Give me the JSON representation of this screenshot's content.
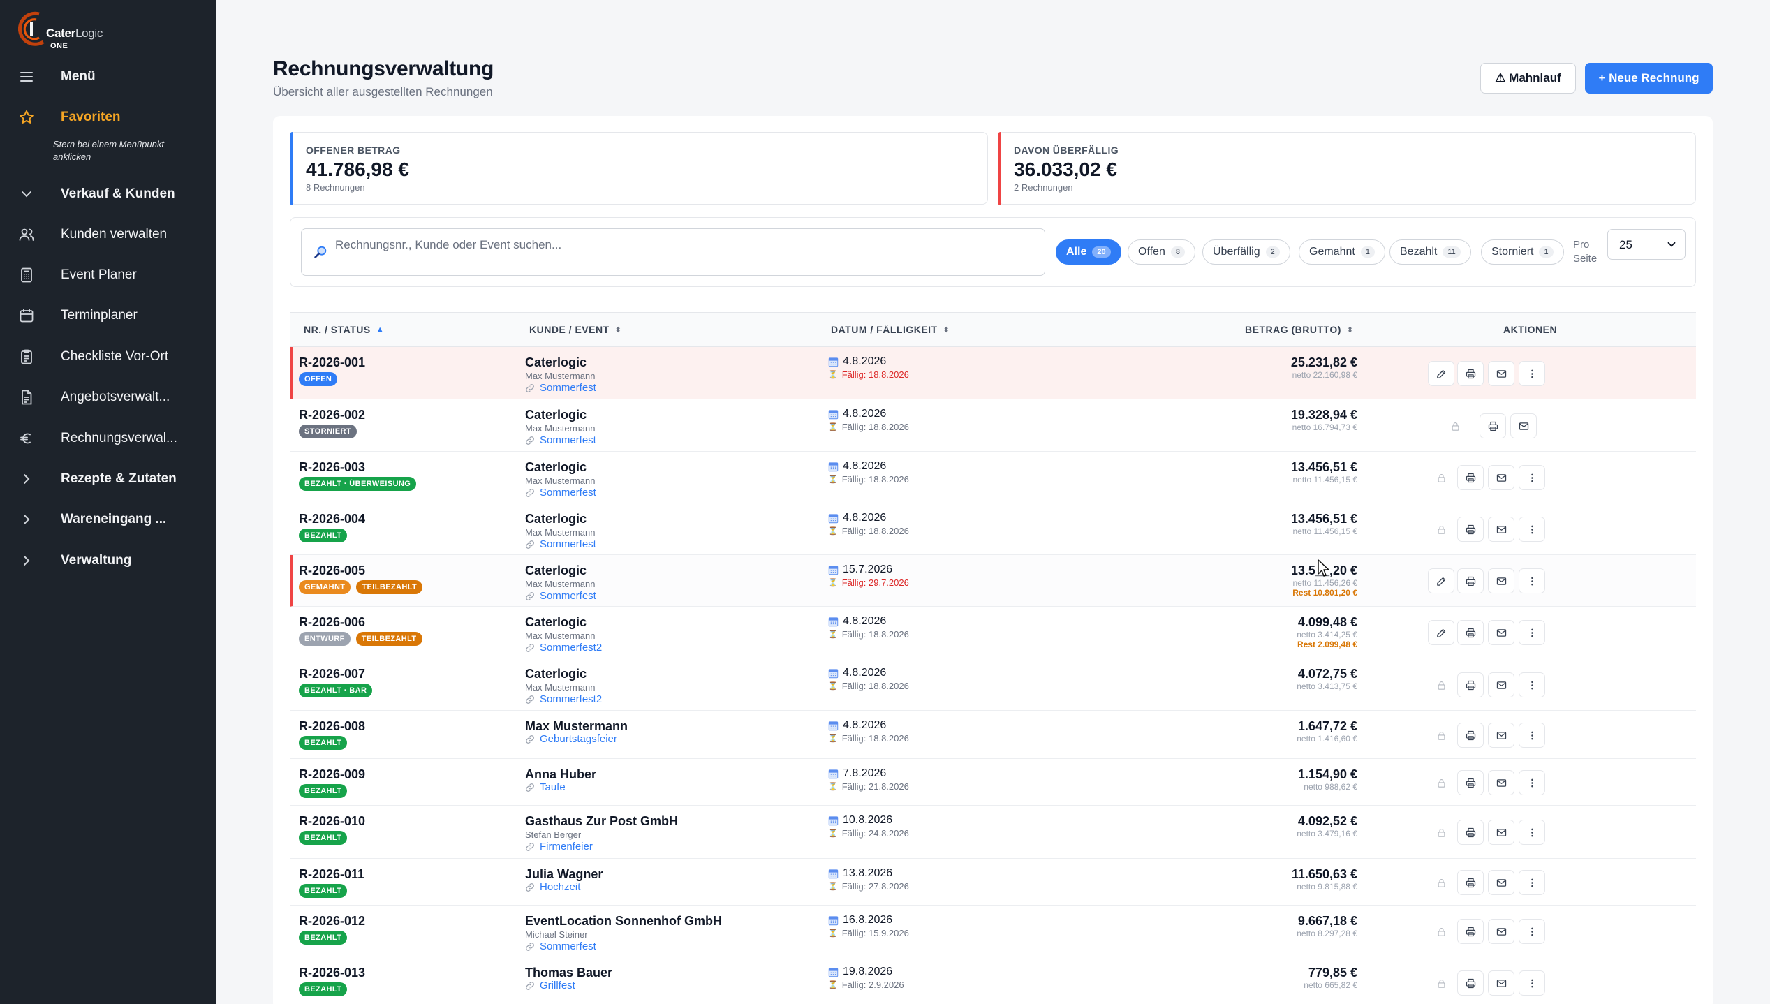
{
  "brand": {
    "name_bold": "Cater",
    "name_light": "Logic",
    "suffix": "ONE"
  },
  "sidebar": {
    "menu_label": "Menü",
    "favorites_label": "Favoriten",
    "favorites_hint": "Stern bei einem Menüpunkt anklicken",
    "items": [
      {
        "label": "Verkauf & Kunden",
        "icon": "chevron-down-icon"
      },
      {
        "label": "Kunden verwalten",
        "icon": "users-icon"
      },
      {
        "label": "Event Planer",
        "icon": "calculator-icon"
      },
      {
        "label": "Terminplaner",
        "icon": "calendar-icon"
      },
      {
        "label": "Checkliste Vor-Ort",
        "icon": "clipboard-icon"
      },
      {
        "label": "Angebotsverwalt...",
        "icon": "document-icon"
      },
      {
        "label": "Rechnungsverwal...",
        "icon": "euro-icon"
      },
      {
        "label": "Rezepte & Zutaten",
        "icon": "chevron-right-icon"
      },
      {
        "label": "Wareneingang ...",
        "icon": "chevron-right-icon"
      },
      {
        "label": "Verwaltung",
        "icon": "chevron-right-icon"
      }
    ]
  },
  "header": {
    "title": "Rechnungsverwaltung",
    "subtitle": "Übersicht aller ausgestellten Rechnungen",
    "mahnlauf_label": "⚠ Mahnlauf",
    "new_invoice_label": "+ Neue Rechnung"
  },
  "stats": {
    "open": {
      "label": "OFFENER BETRAG",
      "value": "41.786,98 €",
      "sub": "8 Rechnungen",
      "color": "#2f7cf6"
    },
    "overdue": {
      "label": "DAVON ÜBERFÄLLIG",
      "value": "36.033,02 €",
      "sub": "2 Rechnungen",
      "color": "#ef4444"
    }
  },
  "filters": {
    "search_placeholder": "Rechnungsnr., Kunde oder Event suchen...",
    "chips": [
      {
        "label": "Alle",
        "count": "20"
      },
      {
        "label": "Offen",
        "count": "8"
      },
      {
        "label": "Überfällig",
        "count": "2"
      },
      {
        "label": "Gemahnt",
        "count": "1"
      },
      {
        "label": "Bezahlt",
        "count": "11"
      },
      {
        "label": "Storniert",
        "count": "1"
      }
    ],
    "per_page_label_1": "Pro",
    "per_page_label_2": "Seite",
    "per_page_value": "25"
  },
  "table": {
    "columns": [
      "NR. / STATUS",
      "KUNDE / EVENT",
      "DATUM / FÄLLIGKEIT",
      "BETRAG (BRUTTO)",
      "AKTIONEN"
    ],
    "sort_icons": [
      "▲",
      "⬍",
      "⬍",
      "⬍"
    ],
    "rows": [
      {
        "nr": "R-2026-001",
        "badges": [
          {
            "text": "OFFEN",
            "color": "#2f7cf6"
          }
        ],
        "customer": "Caterlogic",
        "contact": "Max Mustermann",
        "event": "Sommerfest",
        "date": "4.8.2026",
        "due": "Fällig: 18.8.2026",
        "overdue": true,
        "amount": "25.231,82 €",
        "netto": "netto 22.160,98 €",
        "rest": "",
        "actions": [
          "edit",
          "print",
          "mail",
          "more"
        ]
      },
      {
        "nr": "R-2026-002",
        "badges": [
          {
            "text": "STORNIERT",
            "color": "#6b7280"
          }
        ],
        "customer": "Caterlogic",
        "contact": "Max Mustermann",
        "event": "Sommerfest",
        "date": "4.8.2026",
        "due": "Fällig: 18.8.2026",
        "overdue": false,
        "amount": "19.328,94 €",
        "netto": "netto 16.794,73 €",
        "rest": "",
        "actions": [
          "lock",
          "print",
          "mail"
        ]
      },
      {
        "nr": "R-2026-003",
        "badges": [
          {
            "text": "BEZAHLT · ÜBERWEISUNG",
            "color": "#16a34a"
          }
        ],
        "customer": "Caterlogic",
        "contact": "Max Mustermann",
        "event": "Sommerfest",
        "date": "4.8.2026",
        "due": "Fällig: 18.8.2026",
        "overdue": false,
        "amount": "13.456,51 €",
        "netto": "netto 11.456,15 €",
        "rest": "",
        "actions": [
          "lock",
          "print",
          "mail",
          "more"
        ]
      },
      {
        "nr": "R-2026-004",
        "badges": [
          {
            "text": "BEZAHLT",
            "color": "#16a34a"
          }
        ],
        "customer": "Caterlogic",
        "contact": "Max Mustermann",
        "event": "Sommerfest",
        "date": "4.8.2026",
        "due": "Fällig: 18.8.2026",
        "overdue": false,
        "amount": "13.456,51 €",
        "netto": "netto 11.456,15 €",
        "rest": "",
        "actions": [
          "lock",
          "print",
          "mail",
          "more"
        ]
      },
      {
        "nr": "R-2026-005",
        "badges": [
          {
            "text": "GEMAHNT",
            "color": "#ea8a1e"
          },
          {
            "text": "TEILBEZAHLT",
            "color": "#d97706"
          }
        ],
        "customer": "Caterlogic",
        "contact": "Max Mustermann",
        "event": "Sommerfest",
        "date": "15.7.2026",
        "due": "Fällig: 29.7.2026",
        "overdue": true,
        "amount": "13.5__,20 €",
        "netto": "netto 11.456,26 €",
        "rest": "Rest 10.801,20 €",
        "actions": [
          "edit",
          "print",
          "mail",
          "more"
        ]
      },
      {
        "nr": "R-2026-006",
        "badges": [
          {
            "text": "ENTWURF",
            "color": "#9ca3af"
          },
          {
            "text": "TEILBEZAHLT",
            "color": "#d97706"
          }
        ],
        "customer": "Caterlogic",
        "contact": "Max Mustermann",
        "event": "Sommerfest2",
        "date": "4.8.2026",
        "due": "Fällig: 18.8.2026",
        "overdue": false,
        "amount": "4.099,48 €",
        "netto": "netto 3.414,25 €",
        "rest": "Rest 2.099,48 €",
        "actions": [
          "edit",
          "print",
          "mail",
          "more"
        ]
      },
      {
        "nr": "R-2026-007",
        "badges": [
          {
            "text": "BEZAHLT · BAR",
            "color": "#16a34a"
          }
        ],
        "customer": "Caterlogic",
        "contact": "Max Mustermann",
        "event": "Sommerfest2",
        "date": "4.8.2026",
        "due": "Fällig: 18.8.2026",
        "overdue": false,
        "amount": "4.072,75 €",
        "netto": "netto 3.413,75 €",
        "rest": "",
        "actions": [
          "lock",
          "print",
          "mail",
          "more"
        ]
      },
      {
        "nr": "R-2026-008",
        "badges": [
          {
            "text": "BEZAHLT",
            "color": "#16a34a"
          }
        ],
        "customer": "Max Mustermann",
        "contact": "",
        "event": "Geburtstagsfeier",
        "date": "4.8.2026",
        "due": "Fällig: 18.8.2026",
        "overdue": false,
        "amount": "1.647,72 €",
        "netto": "netto 1.416,60 €",
        "rest": "",
        "actions": [
          "lock",
          "print",
          "mail",
          "more"
        ]
      },
      {
        "nr": "R-2026-009",
        "badges": [
          {
            "text": "BEZAHLT",
            "color": "#16a34a"
          }
        ],
        "customer": "Anna Huber",
        "contact": "",
        "event": "Taufe",
        "date": "7.8.2026",
        "due": "Fällig: 21.8.2026",
        "overdue": false,
        "amount": "1.154,90 €",
        "netto": "netto 988,62 €",
        "rest": "",
        "actions": [
          "lock",
          "print",
          "mail",
          "more"
        ]
      },
      {
        "nr": "R-2026-010",
        "badges": [
          {
            "text": "BEZAHLT",
            "color": "#16a34a"
          }
        ],
        "customer": "Gasthaus Zur Post GmbH",
        "contact": "Stefan Berger",
        "event": "Firmenfeier",
        "date": "10.8.2026",
        "due": "Fällig: 24.8.2026",
        "overdue": false,
        "amount": "4.092,52 €",
        "netto": "netto 3.479,16 €",
        "rest": "",
        "actions": [
          "lock",
          "print",
          "mail",
          "more"
        ]
      },
      {
        "nr": "R-2026-011",
        "badges": [
          {
            "text": "BEZAHLT",
            "color": "#16a34a"
          }
        ],
        "customer": "Julia Wagner",
        "contact": "",
        "event": "Hochzeit",
        "date": "13.8.2026",
        "due": "Fällig: 27.8.2026",
        "overdue": false,
        "amount": "11.650,63 €",
        "netto": "netto 9.815,88 €",
        "rest": "",
        "actions": [
          "lock",
          "print",
          "mail",
          "more"
        ]
      },
      {
        "nr": "R-2026-012",
        "badges": [
          {
            "text": "BEZAHLT",
            "color": "#16a34a"
          }
        ],
        "customer": "EventLocation Sonnenhof GmbH",
        "contact": "Michael Steiner",
        "event": "Sommerfest",
        "date": "16.8.2026",
        "due": "Fällig: 15.9.2026",
        "overdue": false,
        "amount": "9.667,18 €",
        "netto": "netto 8.297,28 €",
        "rest": "",
        "actions": [
          "lock",
          "print",
          "mail",
          "more"
        ]
      },
      {
        "nr": "R-2026-013",
        "badges": [
          {
            "text": "BEZAHLT",
            "color": "#16a34a"
          }
        ],
        "customer": "Thomas Bauer",
        "contact": "",
        "event": "Grillfest",
        "date": "19.8.2026",
        "due": "Fällig: 2.9.2026",
        "overdue": false,
        "amount": "779,85 €",
        "netto": "netto 665,82 €",
        "rest": "",
        "actions": [
          "lock",
          "print",
          "mail",
          "more"
        ]
      }
    ]
  }
}
